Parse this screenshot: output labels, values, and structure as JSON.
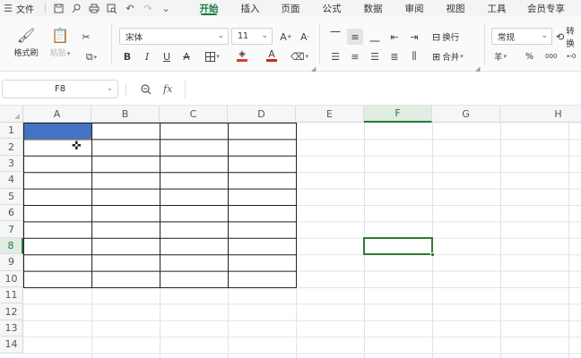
{
  "menubar": {
    "file_label": "文件",
    "quick_icons": [
      "save-icon",
      "print-preview-icon",
      "print-icon",
      "find-icon",
      "undo-icon",
      "redo-icon",
      "more-chevron-icon"
    ],
    "tabs": [
      {
        "label": "开始",
        "active": true
      },
      {
        "label": "插入",
        "active": false
      },
      {
        "label": "页面",
        "active": false
      },
      {
        "label": "公式",
        "active": false
      },
      {
        "label": "数据",
        "active": false
      },
      {
        "label": "审阅",
        "active": false
      },
      {
        "label": "视图",
        "active": false
      },
      {
        "label": "工具",
        "active": false
      },
      {
        "label": "会员专享",
        "active": false
      }
    ]
  },
  "ribbon": {
    "format_painter": "格式刷",
    "paste": "粘贴",
    "font_name": "宋体",
    "font_size": "11",
    "wrap_text": "换行",
    "merge": "合并",
    "number_format": "常规",
    "convert": "转换",
    "currency_symbol": "羊",
    "percent_symbol": "%",
    "thousands": "000",
    "decimal": "←0",
    "bold": "B",
    "italic": "I",
    "underline": "U",
    "strike": "A",
    "font_color_letter": "A",
    "fill_color": "#e03a2f",
    "font_color": "#d6231c"
  },
  "formula_bar": {
    "name_box": "F8",
    "fx": "fx",
    "value": ""
  },
  "grid": {
    "columns": [
      "A",
      "B",
      "C",
      "D",
      "E",
      "F",
      "G",
      "H"
    ],
    "rows": [
      "1",
      "2",
      "3",
      "4",
      "5",
      "6",
      "7",
      "8",
      "9",
      "10",
      "11",
      "12",
      "13",
      "14"
    ],
    "selected_column": "F",
    "selected_row": "8",
    "active_cell": "F8",
    "highlight_cell": "A1",
    "highlight_color": "#4472c4",
    "bordered_range": "A1:D10"
  }
}
